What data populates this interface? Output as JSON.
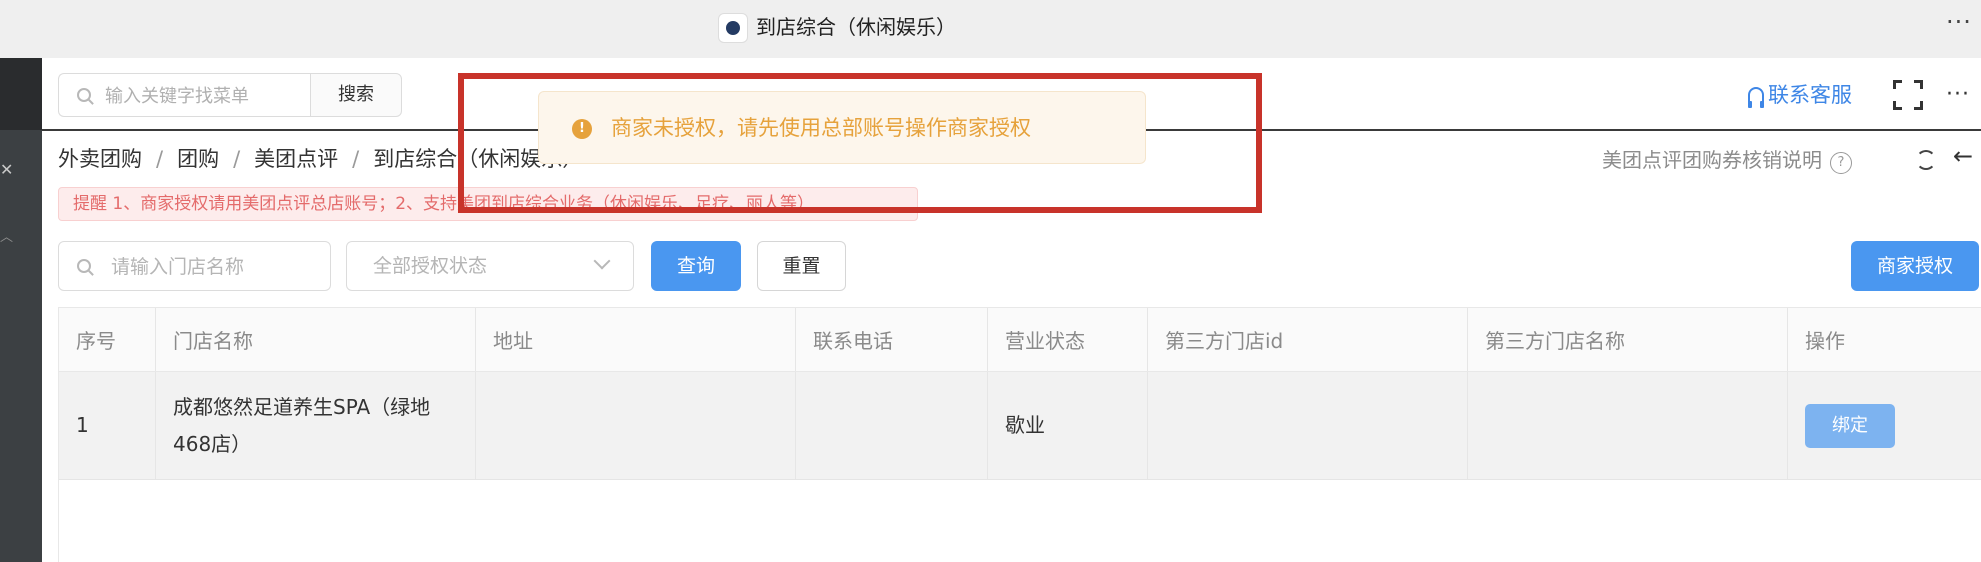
{
  "window": {
    "title": "到店综合（休闲娱乐）",
    "more_glyph": "···"
  },
  "sidebar": {
    "close_glyph": "✕",
    "collapse_glyph": "︿"
  },
  "menu_search": {
    "placeholder": "输入关键字找菜单",
    "button_label": "搜索"
  },
  "header_actions": {
    "support_label": "联系客服",
    "more_glyph": "···"
  },
  "breadcrumb": [
    "外卖团购",
    "团购",
    "美团点评",
    "到店综合（休闲娱乐）"
  ],
  "help": {
    "label": "美团点评团购券核销说明",
    "icon_glyph": "?"
  },
  "back_glyph": "←",
  "notice": "提醒 1、商家授权请用美团点评总店账号；2、支持美团到店综合业务（休闲娱乐、足疗、丽人等）",
  "filters": {
    "store_placeholder": "请输入门店名称",
    "status_selected": "全部授权状态",
    "query_label": "查询",
    "reset_label": "重置",
    "auth_label": "商家授权"
  },
  "table": {
    "headers": [
      "序号",
      "门店名称",
      "地址",
      "联系电话",
      "营业状态",
      "第三方门店id",
      "第三方门店名称",
      "操作"
    ],
    "rows": [
      {
        "index": "1",
        "store_name": "成都悠然足道养生SPA（绿地468店）",
        "address": "",
        "phone": "",
        "status": "歇业",
        "third_party_id": "",
        "third_party_name": "",
        "action": "绑定"
      }
    ]
  },
  "toast": {
    "icon_glyph": "!",
    "message": "商家未授权，请先使用总部账号操作商家授权",
    "color": "#e6a23c"
  },
  "colors": {
    "primary": "#4a97f0",
    "warning": "#e6a23c",
    "notice_text": "#e46b6b",
    "highlight": "#c8332a"
  }
}
